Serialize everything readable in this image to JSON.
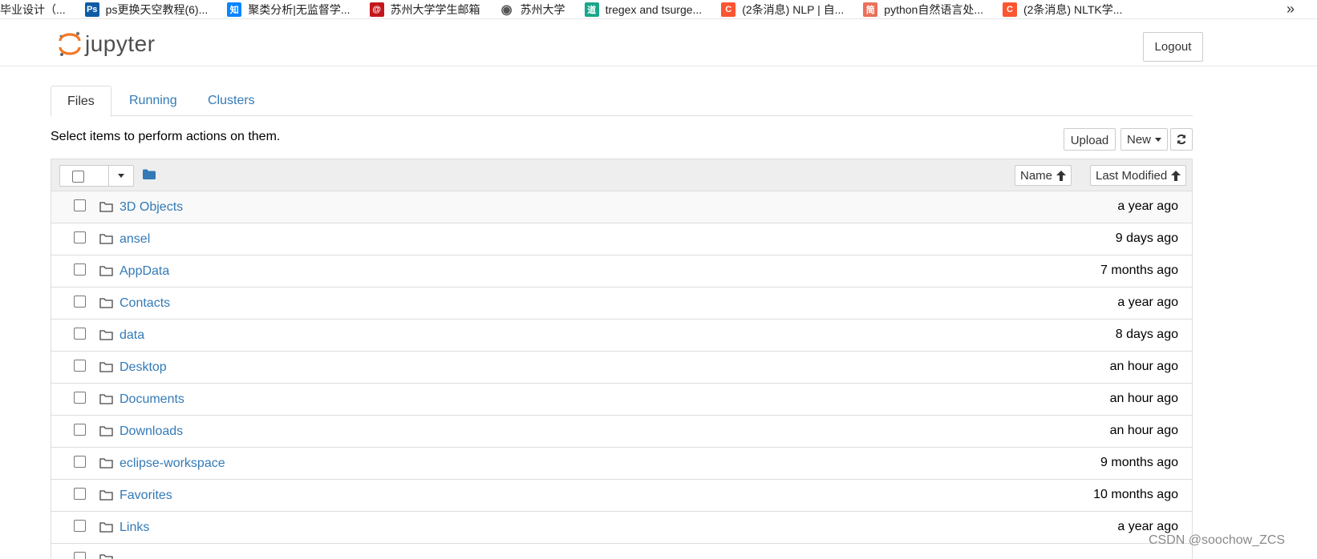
{
  "bookmarks": {
    "items": [
      {
        "label": "毕业设计（...",
        "icon": "none",
        "color": ""
      },
      {
        "label": "ps更换天空教程(6)...",
        "icon": "ps-icon",
        "color": "#0d5ba6",
        "glyph": "Ps"
      },
      {
        "label": "聚类分析|无监督学...",
        "icon": "zhihu-icon",
        "color": "#0a84ff",
        "glyph": "知"
      },
      {
        "label": "苏州大学学生邮箱",
        "icon": "mail-icon",
        "color": "#c4161c",
        "glyph": "@"
      },
      {
        "label": "苏州大学",
        "icon": "globe-icon",
        "color": "#555555",
        "glyph": "◉"
      },
      {
        "label": "tregex and tsurge...",
        "icon": "doc-icon",
        "color": "#18a689",
        "glyph": "道"
      },
      {
        "label": "(2条消息) NLP | 自...",
        "icon": "csdn-icon",
        "color": "#fc5531",
        "glyph": "C"
      },
      {
        "label": "python自然语言处...",
        "icon": "jianshu-icon",
        "color": "#ea6f5a",
        "glyph": "简"
      },
      {
        "label": "(2条消息) NLTK学...",
        "icon": "csdn-icon",
        "color": "#fc5531",
        "glyph": "C"
      }
    ],
    "more": "»"
  },
  "header": {
    "logo_text": "jupyter",
    "logout_label": "Logout"
  },
  "tabs": [
    {
      "label": "Files",
      "active": true
    },
    {
      "label": "Running",
      "active": false
    },
    {
      "label": "Clusters",
      "active": false
    }
  ],
  "toolbar": {
    "hint": "Select items to perform actions on them.",
    "upload_label": "Upload",
    "new_label": "New",
    "refresh_icon": "refresh-icon"
  },
  "list_header": {
    "sort_name_label": "Name",
    "sort_modified_label": "Last Modified"
  },
  "files": [
    {
      "name": "3D Objects",
      "modified": "a year ago"
    },
    {
      "name": "ansel",
      "modified": "9 days ago"
    },
    {
      "name": "AppData",
      "modified": "7 months ago"
    },
    {
      "name": "Contacts",
      "modified": "a year ago"
    },
    {
      "name": "data",
      "modified": "8 days ago"
    },
    {
      "name": "Desktop",
      "modified": "an hour ago"
    },
    {
      "name": "Documents",
      "modified": "an hour ago"
    },
    {
      "name": "Downloads",
      "modified": "an hour ago"
    },
    {
      "name": "eclipse-workspace",
      "modified": "9 months ago"
    },
    {
      "name": "Favorites",
      "modified": "10 months ago"
    },
    {
      "name": "Links",
      "modified": "a year ago"
    },
    {
      "name": "",
      "modified": ""
    }
  ],
  "watermark": "CSDN @soochow_ZCS",
  "colors": {
    "link": "#337ab7",
    "jupyter_orange": "#f37726"
  }
}
